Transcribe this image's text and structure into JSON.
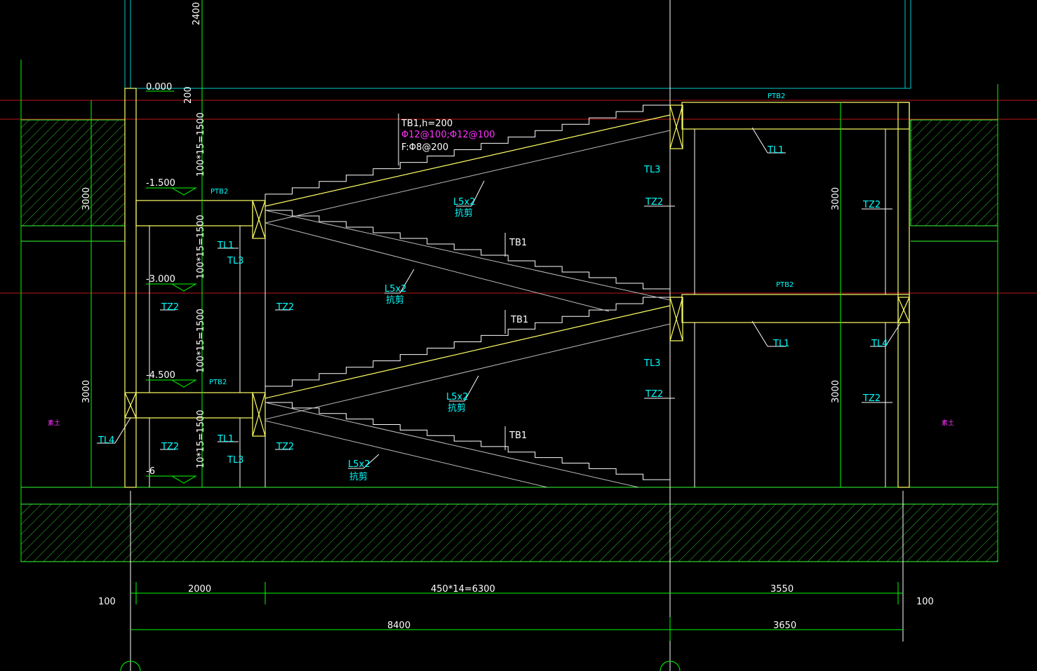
{
  "drawing": {
    "colors": {
      "background": "#000000",
      "structure": "#ffff66",
      "dimension": "#00ff00",
      "grid_red": "#ff2222",
      "hatch": "#33ff33",
      "text_cyan": "#00ffff",
      "text_magenta": "#ff33ff",
      "line_white": "#ffffff"
    },
    "levels": {
      "top": "0.000",
      "l1": "-1.500",
      "l2": "-3.000",
      "l3": "-4.500",
      "bottom": "-6"
    },
    "left_dims": {
      "top": "2400",
      "d200": "200",
      "flight1": "100*15=1500",
      "flight2": "100*15=1500",
      "flight3": "100*15=1500",
      "flight4": "10*15=1500",
      "soil1": "3000",
      "soil2": "3000"
    },
    "right_dims": {
      "upper": "3000",
      "lower": "3000"
    },
    "bottom_dims": {
      "left_offset": "100",
      "right_offset": "100",
      "seg1": "2000",
      "seg2": "450*14=6300",
      "seg3": "3550",
      "total_left": "8400",
      "total_right": "3650"
    },
    "notes": {
      "tb1_spec": "TB1,h=200",
      "tb1_rebar": "Φ12@100;Φ12@100",
      "tb1_f": "F:Φ8@200",
      "tb1_a": "TB1",
      "tb1_b": "TB1",
      "tb1_c": "TB1"
    },
    "tags": {
      "ptb2_a": "PTB2",
      "ptb2_b": "PTB2",
      "ptb2_c": "PTB2",
      "ptb2_d": "PTB2",
      "tl1_a": "TL1",
      "tl1_b": "TL1",
      "tl1_c": "TL1",
      "tl1_d": "TL1",
      "tl3_a": "TL3",
      "tl3_b": "TL3",
      "tl3_c": "TL3",
      "tl3_d": "TL3",
      "tl4_a": "TL4",
      "tl4_b": "TL4",
      "tz2_a": "TZ2",
      "tz2_b": "TZ2",
      "tz2_c": "TZ2",
      "tz2_d": "TZ2",
      "tz2_e": "TZ2",
      "tz2_f": "TZ2",
      "tz2_g": "TZ2",
      "tz2_h": "TZ2",
      "l5_a": "L5x2",
      "l5_b": "L5x2",
      "l5_c": "L5x2",
      "l5_d": "L5x2",
      "l5_sub_a": "抗剪",
      "l5_sub_b": "抗剪",
      "l5_sub_c": "抗剪",
      "l5_sub_d": "抗剪"
    },
    "soil_marks": {
      "left": "素土",
      "right": "素土"
    }
  }
}
